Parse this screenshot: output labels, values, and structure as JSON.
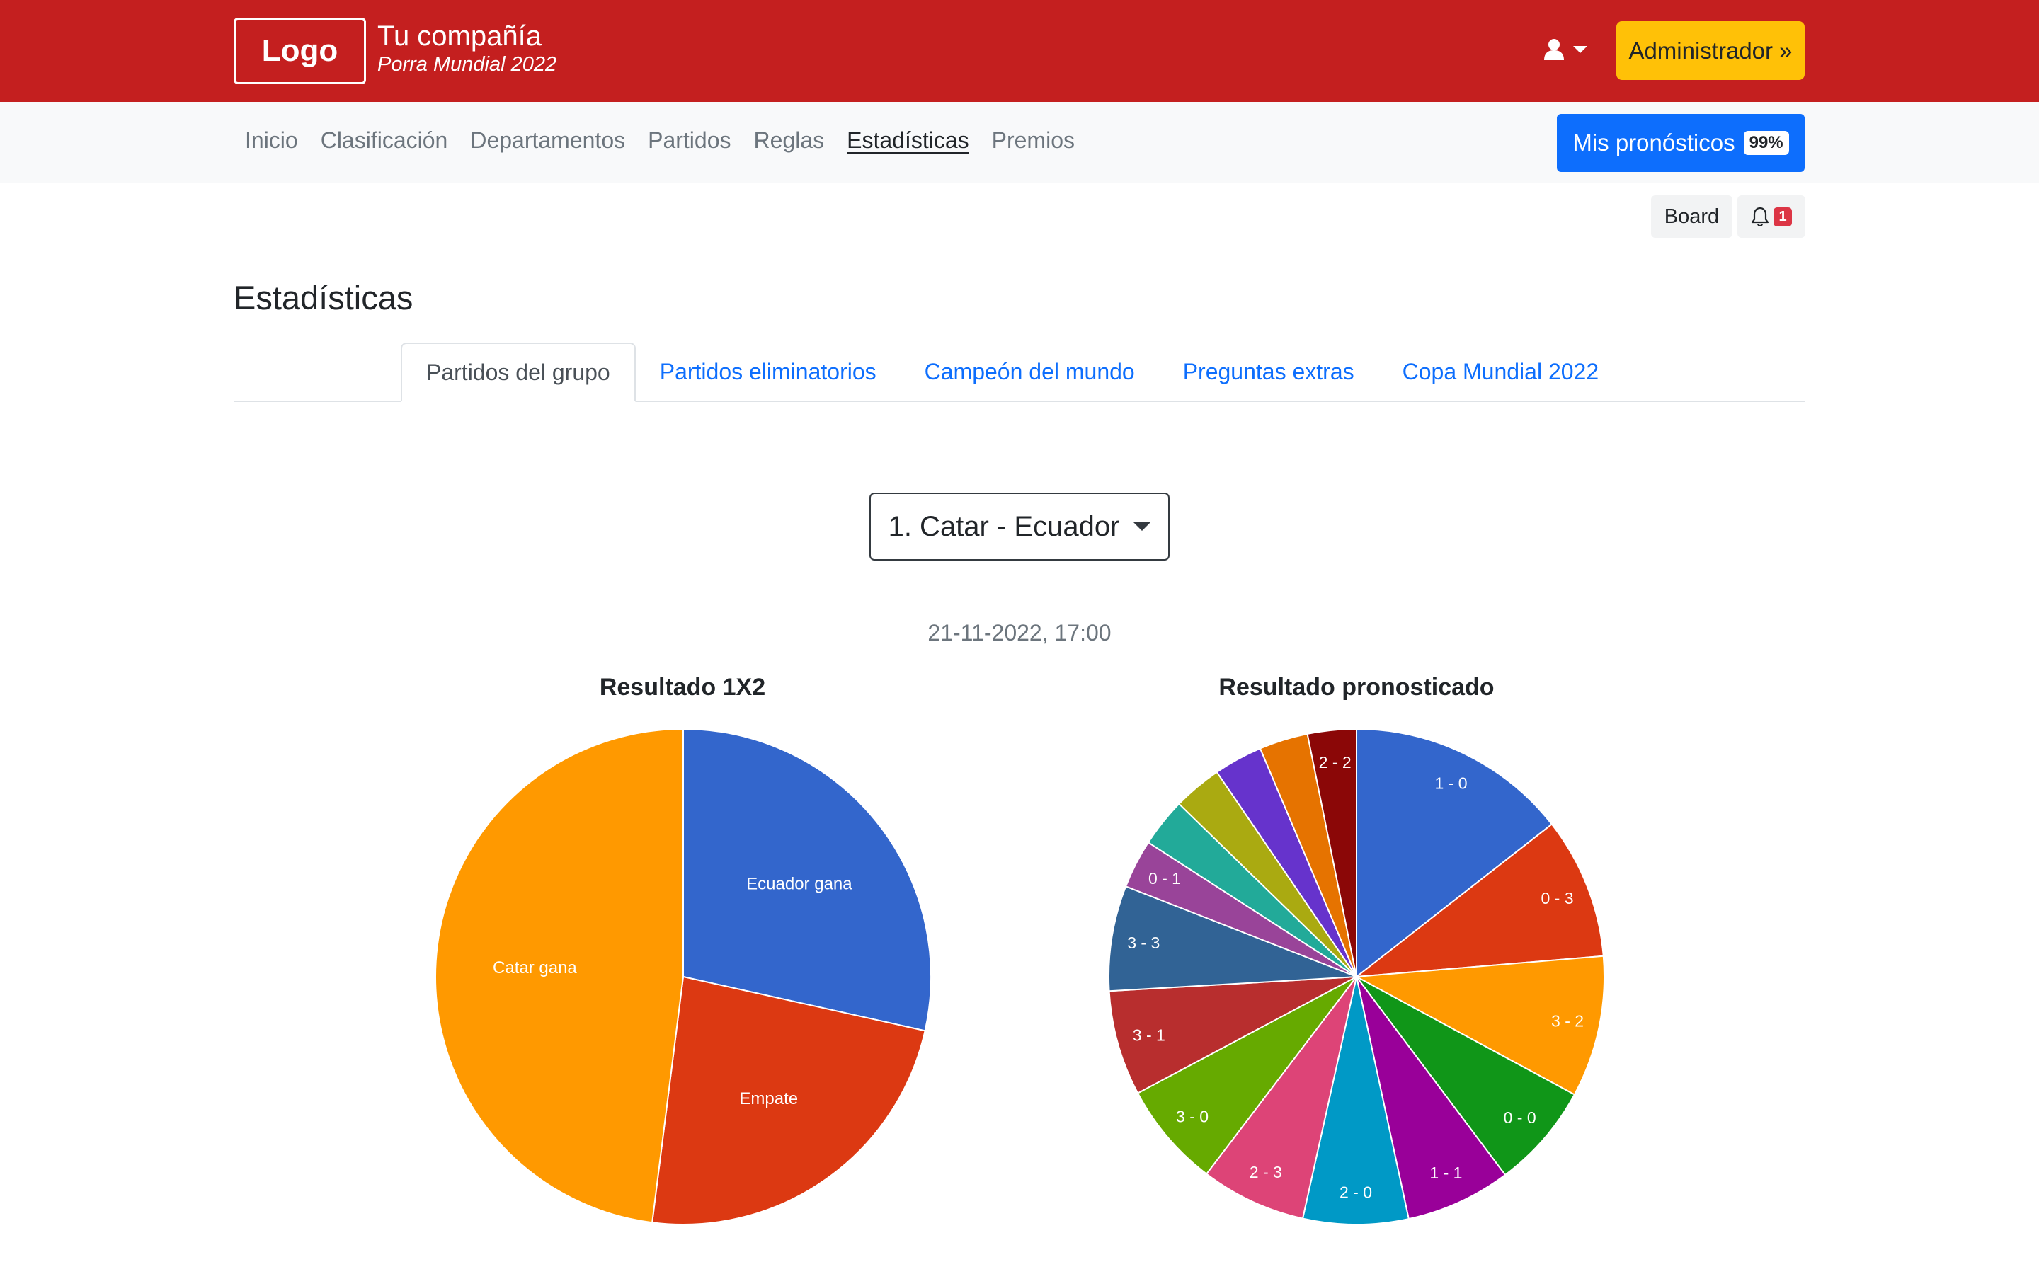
{
  "header": {
    "logo": "Logo",
    "company_name": "Tu compañía",
    "company_sub": "Porra Mundial 2022",
    "admin_button": "Administrador »"
  },
  "nav": {
    "items": [
      {
        "label": "Inicio"
      },
      {
        "label": "Clasificación"
      },
      {
        "label": "Departamentos"
      },
      {
        "label": "Partidos"
      },
      {
        "label": "Reglas"
      },
      {
        "label": "Estadísticas"
      },
      {
        "label": "Premios"
      }
    ],
    "active": "Estadísticas",
    "mis_pronosticos": "Mis pronósticos",
    "progress_badge": "99%"
  },
  "tools": {
    "board": "Board",
    "notifications": "1"
  },
  "page": {
    "title": "Estadísticas",
    "tabs": [
      {
        "label": "Partidos del grupo"
      },
      {
        "label": "Partidos eliminatorios"
      },
      {
        "label": "Campeón del mundo"
      },
      {
        "label": "Preguntas extras"
      },
      {
        "label": "Copa Mundial 2022"
      }
    ],
    "selected_match": "1. Catar - Ecuador",
    "match_date": "21-11-2022, 17:00"
  },
  "colors": {
    "brand_red": "#c41f1f",
    "admin_yellow": "#ffc107",
    "primary_blue": "#0d6efd"
  },
  "chart_data": [
    {
      "type": "pie",
      "title": "Resultado 1X2",
      "slices": [
        {
          "label": "Ecuador gana",
          "value": 28.5,
          "color": "#3366cc"
        },
        {
          "label": "Empate",
          "value": 23.5,
          "color": "#dc3912"
        },
        {
          "label": "Catar gana",
          "value": 48.0,
          "color": "#ff9900"
        }
      ]
    },
    {
      "type": "pie",
      "title": "Resultado pronosticado",
      "slices": [
        {
          "label": "1 - 0",
          "value": 14.1,
          "color": "#3366cc"
        },
        {
          "label": "0 - 3",
          "value": 9.0,
          "color": "#dc3912"
        },
        {
          "label": "3 - 2",
          "value": 9.0,
          "color": "#ff9900"
        },
        {
          "label": "0 - 0",
          "value": 6.7,
          "color": "#109618"
        },
        {
          "label": "1 - 1",
          "value": 6.7,
          "color": "#990099"
        },
        {
          "label": "2 - 0",
          "value": 6.7,
          "color": "#0099c6"
        },
        {
          "label": "2 - 3",
          "value": 6.7,
          "color": "#dd4477"
        },
        {
          "label": "3 - 0",
          "value": 6.7,
          "color": "#66aa00"
        },
        {
          "label": "3 - 1",
          "value": 6.7,
          "color": "#b82e2e"
        },
        {
          "label": "3 - 3",
          "value": 6.7,
          "color": "#316395"
        },
        {
          "label": "0 - 1",
          "value": 3.1,
          "color": "#994499"
        },
        {
          "label": "",
          "value": 3.1,
          "color": "#22aa99"
        },
        {
          "label": "",
          "value": 3.1,
          "color": "#aaaa11"
        },
        {
          "label": "",
          "value": 3.1,
          "color": "#6633cc"
        },
        {
          "label": "",
          "value": 3.1,
          "color": "#e67300"
        },
        {
          "label": "2 - 2",
          "value": 3.1,
          "color": "#8b0707"
        }
      ]
    }
  ]
}
